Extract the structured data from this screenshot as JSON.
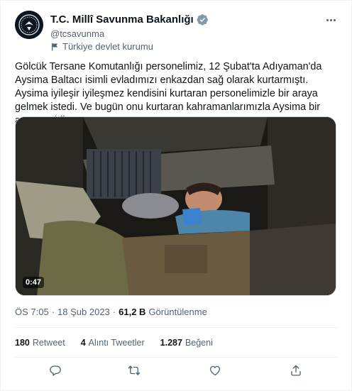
{
  "author": {
    "display_name": "T.C. Millî Savunma Bakanlığı",
    "handle": "@tcsavunma",
    "affiliation": "Türkiye devlet kurumu",
    "verified_color": "#829aab"
  },
  "tweet": {
    "text": "Gölcük Tersane Komutanlığı personelimiz, 12 Şubat'ta Adıyaman'da Aysima Baltacı isimli evladımızı enkazdan sağ olarak kurtarmıştı. Aysima iyileşir iyileşmez kendisini kurtaran personelimizle bir araya gelmek istedi. Ve bugün onu kurtaran kahramanlarımızla Aysima bir araya geldi.",
    "video_duration": "0:47",
    "time": "ÖS 7:05",
    "date": "18 Şub 2023",
    "separator": "·",
    "views_count": "61,2 B",
    "views_label": "Görüntülenme"
  },
  "stats": [
    {
      "count": "180",
      "label": "Retweet"
    },
    {
      "count": "4",
      "label": "Alıntı Tweetler"
    },
    {
      "count": "1.287",
      "label": "Beğeni"
    }
  ],
  "actions": [
    {
      "icon": "reply-icon"
    },
    {
      "icon": "retweet-icon"
    },
    {
      "icon": "like-icon"
    },
    {
      "icon": "share-icon"
    }
  ],
  "colors": {
    "text": "#0f1419",
    "secondary": "#536471",
    "border": "#eff3f4"
  }
}
